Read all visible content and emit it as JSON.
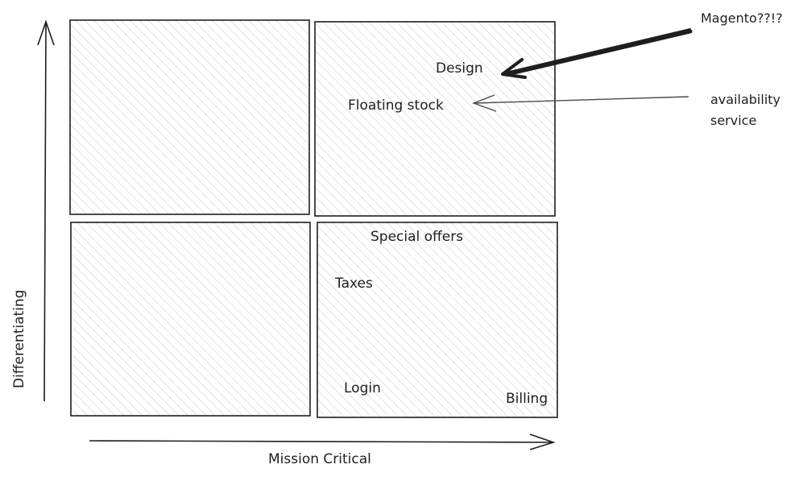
{
  "axes": {
    "y_label": "Differentiating",
    "x_label": "Mission Critical"
  },
  "quadrants": {
    "top_left": {
      "items": []
    },
    "top_right": {
      "items": [
        "Design",
        "Floating stock"
      ]
    },
    "bottom_left": {
      "items": []
    },
    "bottom_right": {
      "items": [
        "Special offers",
        "Taxes",
        "Login",
        "Billing"
      ]
    }
  },
  "annotations": {
    "magento": "Magento??!?",
    "availability_line1": "availability",
    "availability_line2": "service"
  },
  "colors": {
    "stroke": "#1e1e1e",
    "hatch": "#c9c9c9"
  }
}
